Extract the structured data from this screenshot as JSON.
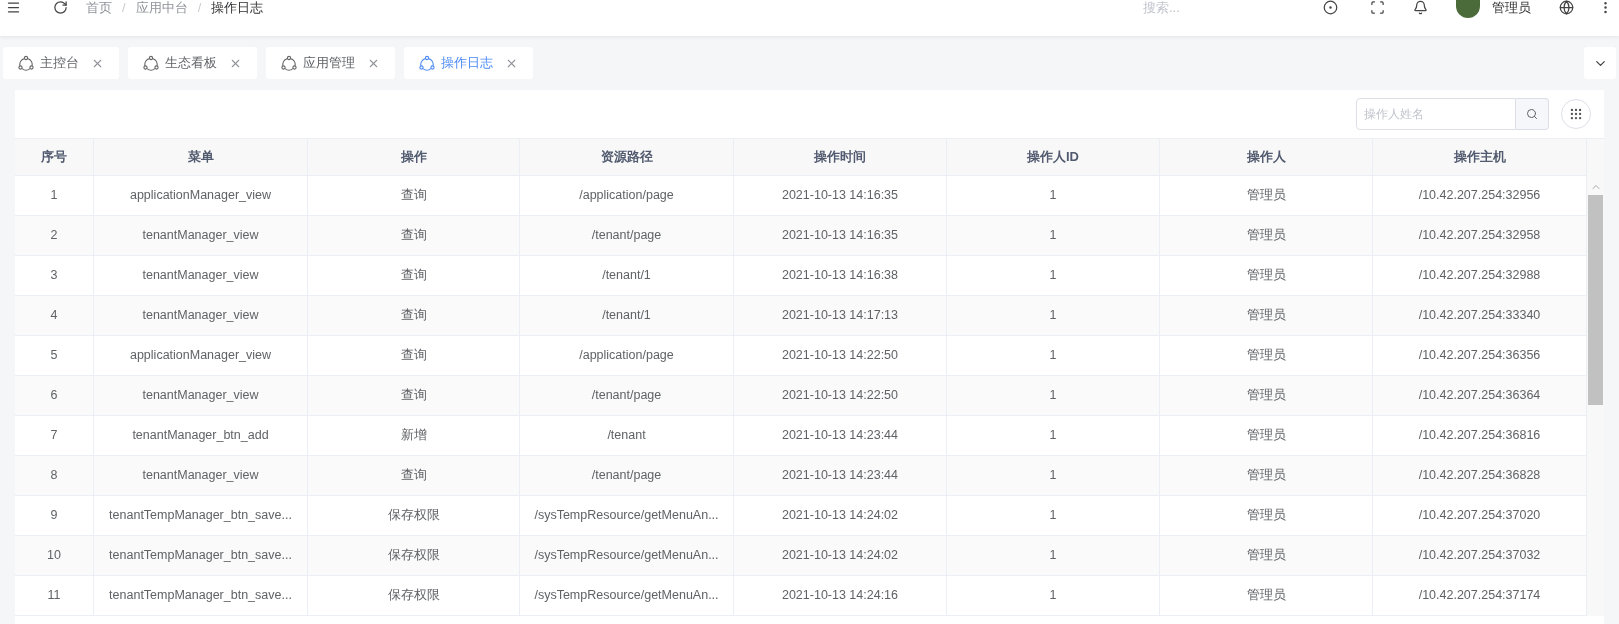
{
  "breadcrumb": [
    {
      "label": "首页",
      "current": false
    },
    {
      "label": "应用中台",
      "current": false,
      "separator": "/"
    },
    {
      "label": "操作日志",
      "current": true,
      "separator": "/"
    }
  ],
  "search": {
    "placeholder": "搜索..."
  },
  "user": {
    "name": "管理员"
  },
  "tabs": [
    {
      "label": "主控台",
      "selected": false
    },
    {
      "label": "生态看板",
      "selected": false
    },
    {
      "label": "应用管理",
      "selected": false
    },
    {
      "label": "操作日志",
      "selected": true
    }
  ],
  "filter": {
    "placeholder": "操作人姓名"
  },
  "table": {
    "columns": [
      "序号",
      "菜单",
      "操作",
      "资源路径",
      "操作时间",
      "操作人ID",
      "操作人",
      "操作主机"
    ],
    "rows": [
      [
        "1",
        "applicationManager_view",
        "查询",
        "/application/page",
        "2021-10-13 14:16:35",
        "1",
        "管理员",
        "/10.42.207.254:32956"
      ],
      [
        "2",
        "tenantManager_view",
        "查询",
        "/tenant/page",
        "2021-10-13 14:16:35",
        "1",
        "管理员",
        "/10.42.207.254:32958"
      ],
      [
        "3",
        "tenantManager_view",
        "查询",
        "/tenant/1",
        "2021-10-13 14:16:38",
        "1",
        "管理员",
        "/10.42.207.254:32988"
      ],
      [
        "4",
        "tenantManager_view",
        "查询",
        "/tenant/1",
        "2021-10-13 14:17:13",
        "1",
        "管理员",
        "/10.42.207.254:33340"
      ],
      [
        "5",
        "applicationManager_view",
        "查询",
        "/application/page",
        "2021-10-13 14:22:50",
        "1",
        "管理员",
        "/10.42.207.254:36356"
      ],
      [
        "6",
        "tenantManager_view",
        "查询",
        "/tenant/page",
        "2021-10-13 14:22:50",
        "1",
        "管理员",
        "/10.42.207.254:36364"
      ],
      [
        "7",
        "tenantManager_btn_add",
        "新增",
        "/tenant",
        "2021-10-13 14:23:44",
        "1",
        "管理员",
        "/10.42.207.254:36816"
      ],
      [
        "8",
        "tenantManager_view",
        "查询",
        "/tenant/page",
        "2021-10-13 14:23:44",
        "1",
        "管理员",
        "/10.42.207.254:36828"
      ],
      [
        "9",
        "tenantTempManager_btn_save...",
        "保存权限",
        "/sysTempResource/getMenuAn...",
        "2021-10-13 14:24:02",
        "1",
        "管理员",
        "/10.42.207.254:37020"
      ],
      [
        "10",
        "tenantTempManager_btn_save...",
        "保存权限",
        "/sysTempResource/getMenuAn...",
        "2021-10-13 14:24:02",
        "1",
        "管理员",
        "/10.42.207.254:37032"
      ],
      [
        "11",
        "tenantTempManager_btn_save...",
        "保存权限",
        "/sysTempResource/getMenuAn...",
        "2021-10-13 14:24:16",
        "1",
        "管理员",
        "/10.42.207.254:37174"
      ]
    ]
  }
}
